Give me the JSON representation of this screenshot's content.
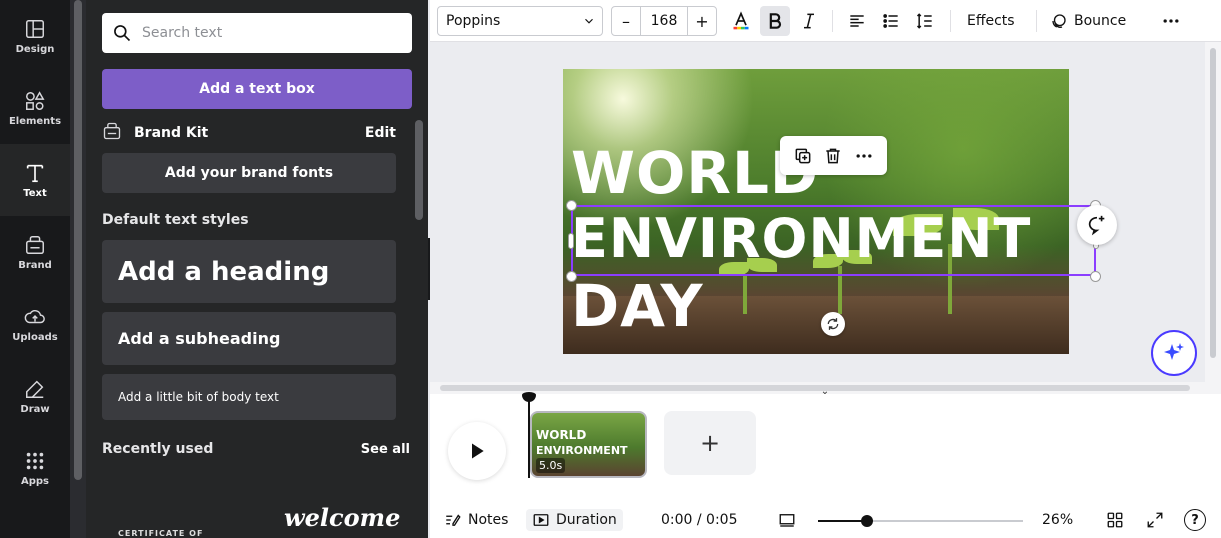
{
  "rail": {
    "items": [
      {
        "label": "Design",
        "icon": "design-icon"
      },
      {
        "label": "Elements",
        "icon": "elements-icon"
      },
      {
        "label": "Text",
        "icon": "text-icon"
      },
      {
        "label": "Brand",
        "icon": "brand-icon"
      },
      {
        "label": "Uploads",
        "icon": "uploads-icon"
      },
      {
        "label": "Draw",
        "icon": "draw-icon"
      },
      {
        "label": "Apps",
        "icon": "apps-icon"
      }
    ]
  },
  "panel": {
    "search_placeholder": "Search text",
    "add_textbox_label": "Add a text box",
    "brand_kit": {
      "title": "Brand Kit",
      "edit_label": "Edit",
      "add_fonts_label": "Add your brand fonts"
    },
    "default_styles_title": "Default text styles",
    "heading_label": "Add a heading",
    "subheading_label": "Add a subheading",
    "body_label": "Add a little bit of body text",
    "recently_used_title": "Recently used",
    "see_all_label": "See all",
    "recent_items": [
      "CERTIFICATE OF",
      "welcome"
    ]
  },
  "toolbar": {
    "font_family": "Poppins",
    "font_size": "168",
    "minus": "–",
    "plus": "+",
    "effects_label": "Effects",
    "animate_label": "Bounce"
  },
  "design": {
    "line1": "WORLD",
    "line2": "ENVIRONMENT",
    "line3": "DAY"
  },
  "timeline": {
    "clip_line1": "WORLD",
    "clip_line2": "ENVIRONMENT",
    "clip_duration": "5.0s",
    "add_page": "+"
  },
  "footer": {
    "notes_label": "Notes",
    "duration_label": "Duration",
    "time_readout": "0:00 / 0:05",
    "zoom_level": "26%",
    "zoom_fraction": 0.24,
    "help": "?"
  },
  "colors": {
    "accent": "#7d5ec8",
    "selection": "#8b3dff",
    "panel_bg": "#252627",
    "rail_bg": "#18191b"
  }
}
